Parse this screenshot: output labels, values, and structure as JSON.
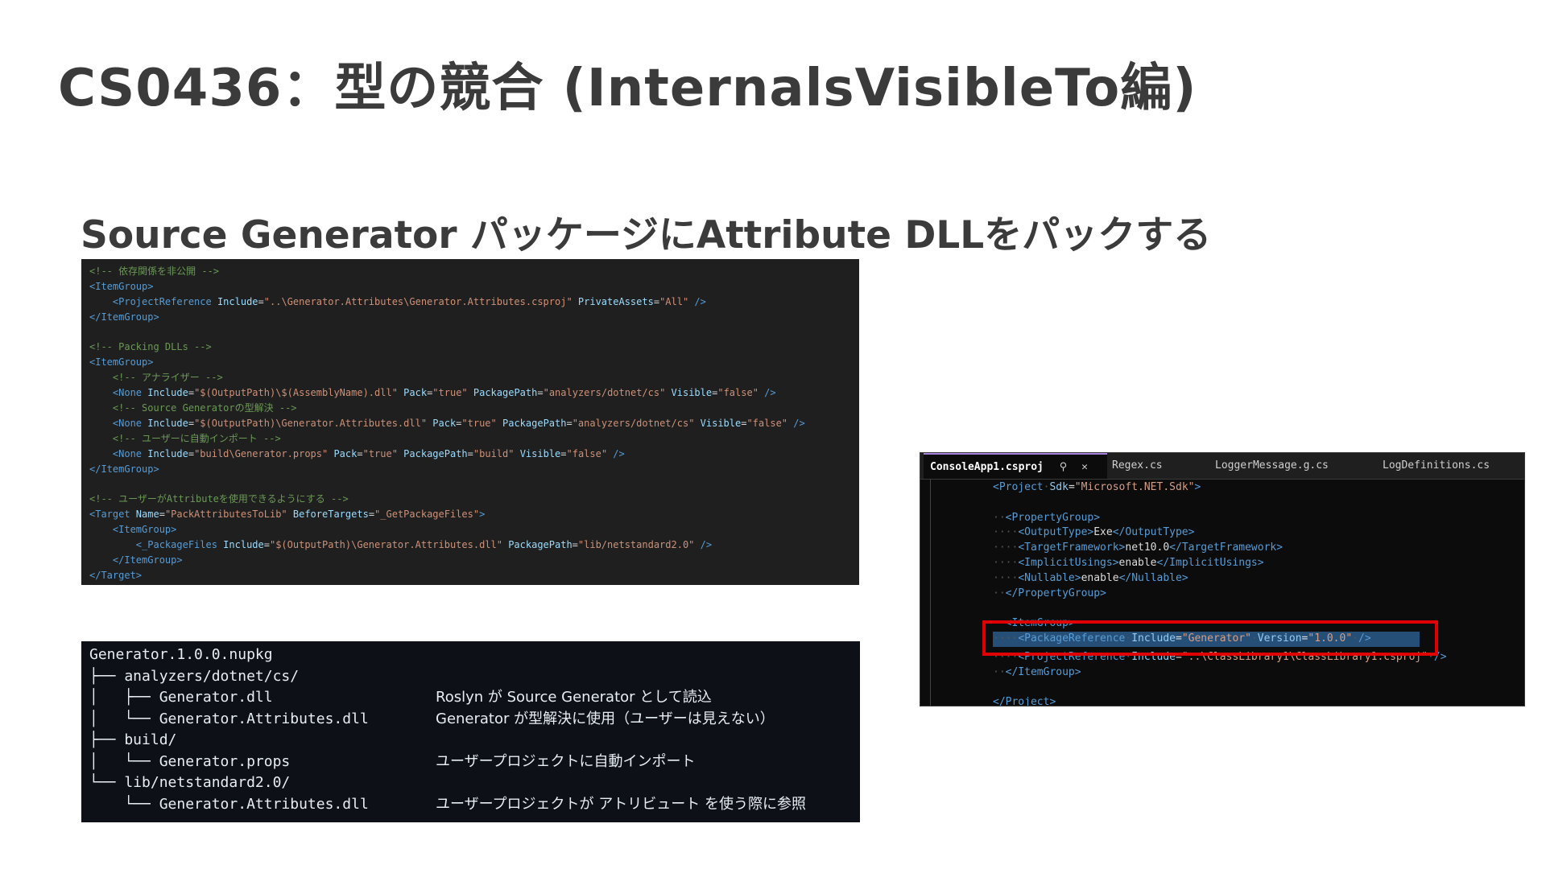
{
  "slide": {
    "title": "CS0436：型の競合 (InternalsVisibleTo編)",
    "subtitle": "Source Generator パッケージにAttribute DLLをパックする"
  },
  "code_panel": {
    "lines": [
      {
        "comment": "<!-- 依存関係を非公開 -->"
      },
      {
        "open": "<ItemGroup>"
      },
      {
        "indent": "    ",
        "tag": "<ProjectReference",
        "attrs": [
          {
            "n": "Include",
            "v": "\"..\\Generator.Attributes\\Generator.Attributes.csproj\""
          },
          {
            "n": "PrivateAssets",
            "v": "\"All\""
          }
        ],
        "end": " />"
      },
      {
        "open": "</ItemGroup>"
      },
      {
        "blank": ""
      },
      {
        "comment": "<!-- Packing DLLs -->"
      },
      {
        "open": "<ItemGroup>"
      },
      {
        "indent": "    ",
        "comment": "<!-- アナライザー -->"
      },
      {
        "indent": "    ",
        "tag": "<None",
        "attrs": [
          {
            "n": "Include",
            "v": "\"$(OutputPath)\\$(AssemblyName).dll\""
          },
          {
            "n": "Pack",
            "v": "\"true\""
          },
          {
            "n": "PackagePath",
            "v": "\"analyzers/dotnet/cs\""
          },
          {
            "n": "Visible",
            "v": "\"false\""
          }
        ],
        "end": " />"
      },
      {
        "indent": "    ",
        "comment": "<!-- Source Generatorの型解決 -->"
      },
      {
        "indent": "    ",
        "tag": "<None",
        "attrs": [
          {
            "n": "Include",
            "v": "\"$(OutputPath)\\Generator.Attributes.dll\""
          },
          {
            "n": "Pack",
            "v": "\"true\""
          },
          {
            "n": "PackagePath",
            "v": "\"analyzers/dotnet/cs\""
          },
          {
            "n": "Visible",
            "v": "\"false\""
          }
        ],
        "end": " />"
      },
      {
        "indent": "    ",
        "comment": "<!-- ユーザーに自動インポート -->"
      },
      {
        "indent": "    ",
        "tag": "<None",
        "attrs": [
          {
            "n": "Include",
            "v": "\"build\\Generator.props\""
          },
          {
            "n": "Pack",
            "v": "\"true\""
          },
          {
            "n": "PackagePath",
            "v": "\"build\""
          },
          {
            "n": "Visible",
            "v": "\"false\""
          }
        ],
        "end": " />"
      },
      {
        "open": "</ItemGroup>"
      },
      {
        "blank": ""
      },
      {
        "comment": "<!-- ユーザーがAttributeを使用できるようにする -->"
      },
      {
        "indent": "",
        "tag": "<Target",
        "attrs": [
          {
            "n": "Name",
            "v": "\"PackAttributesToLib\""
          },
          {
            "n": "BeforeTargets",
            "v": "\"_GetPackageFiles\""
          }
        ],
        "end": ">"
      },
      {
        "indent": "    ",
        "open": "<ItemGroup>"
      },
      {
        "indent": "        ",
        "tag": "<_PackageFiles",
        "attrs": [
          {
            "n": "Include",
            "v": "\"$(OutputPath)\\Generator.Attributes.dll\""
          },
          {
            "n": "PackagePath",
            "v": "\"lib/netstandard2.0\""
          }
        ],
        "end": " />"
      },
      {
        "indent": "    ",
        "open": "</ItemGroup>"
      },
      {
        "open": "</Target>"
      }
    ]
  },
  "tree_panel": {
    "lines": [
      {
        "path": "Generator.1.0.0.nupkg",
        "note": ""
      },
      {
        "path": "├── analyzers/dotnet/cs/",
        "note": ""
      },
      {
        "path": "│   ├── Generator.dll",
        "note": "Roslyn が Source Generator として読込"
      },
      {
        "path": "│   └── Generator.Attributes.dll",
        "note": "Generator が型解決に使用（ユーザーは見えない）"
      },
      {
        "path": "├── build/",
        "note": ""
      },
      {
        "path": "│   └── Generator.props",
        "note": "ユーザープロジェクトに自動インポート"
      },
      {
        "path": "└── lib/netstandard2.0/",
        "note": ""
      },
      {
        "path": "    └── Generator.Attributes.dll",
        "note": "ユーザープロジェクトが アトリビュート を使う際に参照"
      }
    ]
  },
  "vs_panel": {
    "tabs": [
      {
        "label": "ConsoleApp1.csproj",
        "active": true
      },
      {
        "label": "Regex.cs",
        "active": false
      },
      {
        "label": "LoggerMessage.g.cs",
        "active": false
      },
      {
        "label": "LogDefinitions.cs",
        "active": false
      }
    ],
    "icons": {
      "pin": "pin-icon",
      "close": "close-icon"
    },
    "lines": [
      "<Project·Sdk=\"Microsoft.NET.Sdk\">",
      "",
      "··<PropertyGroup>",
      "····<OutputType>Exe</OutputType>",
      "····<TargetFramework>net10.0</TargetFramework>",
      "····<ImplicitUsings>enable</ImplicitUsings>",
      "····<Nullable>enable</Nullable>",
      "··</PropertyGroup>",
      "",
      "··<ItemGroup>",
      "····<PackageReference·Include=\"Generator\"·Version=\"1.0.0\"·/>",
      "····<ProjectReference·Include=\"..\\ClassLibrary1\\ClassLibrary1.csproj\"·/>",
      "··</ItemGroup>",
      "",
      "</Project>"
    ],
    "highlight_color": "#e00000"
  }
}
